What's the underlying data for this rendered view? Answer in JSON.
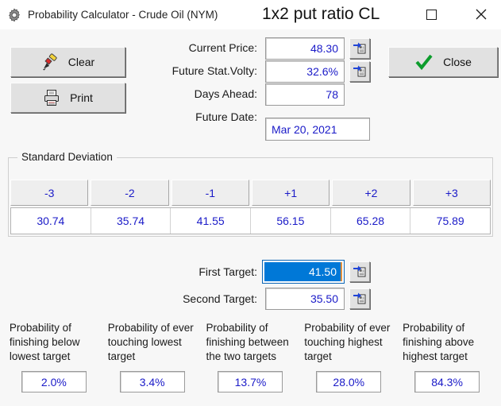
{
  "window": {
    "title": "Probability Calculator - Crude Oil (NYM)",
    "overlay_title": "1x2 put ratio CL",
    "icon": "gear-icon",
    "controls": {
      "maximize": "maximize-icon",
      "close": "close-icon"
    }
  },
  "buttons": {
    "clear": {
      "label": "Clear",
      "icon": "eraser-icon"
    },
    "print": {
      "label": "Print",
      "icon": "printer-icon"
    },
    "close": {
      "label": "Close",
      "icon": "checkmark-icon"
    }
  },
  "fields": {
    "current_price": {
      "label": "Current Price:",
      "value": "48.30"
    },
    "future_stat_volty": {
      "label": "Future Stat.Volty:",
      "value": "32.6%"
    },
    "days_ahead": {
      "label": "Days Ahead:",
      "value": "78"
    },
    "future_date": {
      "label": "Future Date:",
      "value": "Mar 20, 2021"
    },
    "first_target": {
      "label": "First Target:",
      "value": "41.50"
    },
    "second_target": {
      "label": "Second Target:",
      "value": "35.50"
    }
  },
  "standard_deviation": {
    "legend": "Standard Deviation",
    "headers": [
      "-3",
      "-2",
      "-1",
      "+1",
      "+2",
      "+3"
    ],
    "values": [
      "30.74",
      "35.74",
      "41.55",
      "56.15",
      "65.28",
      "75.89"
    ]
  },
  "probabilities": [
    {
      "label": "Probability of finishing below lowest target",
      "value": "2.0%"
    },
    {
      "label": "Probability of ever touching lowest target",
      "value": "3.4%"
    },
    {
      "label": "Probability of finishing between the two targets",
      "value": "13.7%"
    },
    {
      "label": "Probability of ever touching highest target",
      "value": "28.0%"
    },
    {
      "label": "Probability of finishing above highest target",
      "value": "84.3%"
    }
  ],
  "colors": {
    "value_blue": "#1a1ac8",
    "selection_blue": "#0078d7",
    "face": "#e1e1e1",
    "background": "#f7f7f7",
    "check_green": "#0c9c2c"
  }
}
